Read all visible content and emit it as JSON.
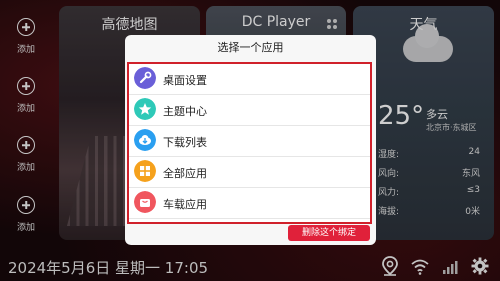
{
  "left_sidebar": {
    "items": [
      {
        "label": "添加"
      },
      {
        "label": "添加"
      },
      {
        "label": "添加"
      },
      {
        "label": "添加"
      }
    ]
  },
  "cards": {
    "map": {
      "title": "高德地图"
    },
    "player": {
      "title": "DC Player"
    },
    "weather": {
      "title": "天气",
      "temperature": "25°",
      "condition": "多云",
      "location": "北京市·东城区",
      "rows": [
        {
          "label": "湿度:",
          "value": "24"
        },
        {
          "label": "风向:",
          "value": "东风"
        },
        {
          "label": "风力:",
          "value": "≤3"
        },
        {
          "label": "海拔:",
          "value": "0米"
        }
      ]
    }
  },
  "status_bar": {
    "datetime": "2024年5月6日 星期一 17:05"
  },
  "dialog": {
    "title": "选择一个应用",
    "apps": [
      {
        "label": "桌面设置",
        "icon": "wrench-icon",
        "color": "#6a5fd8"
      },
      {
        "label": "主题中心",
        "icon": "star-icon",
        "color": "#2ec9b8"
      },
      {
        "label": "下载列表",
        "icon": "download-cloud-icon",
        "color": "#2a9ff0"
      },
      {
        "label": "全部应用",
        "icon": "grid-icon",
        "color": "#f5a11c"
      },
      {
        "label": "车载应用",
        "icon": "bag-icon",
        "color": "#f0565e"
      }
    ],
    "delete_button": "删除这个绑定"
  },
  "colors": {
    "accent_red": "#d0212b",
    "button_red": "#e0213a"
  }
}
